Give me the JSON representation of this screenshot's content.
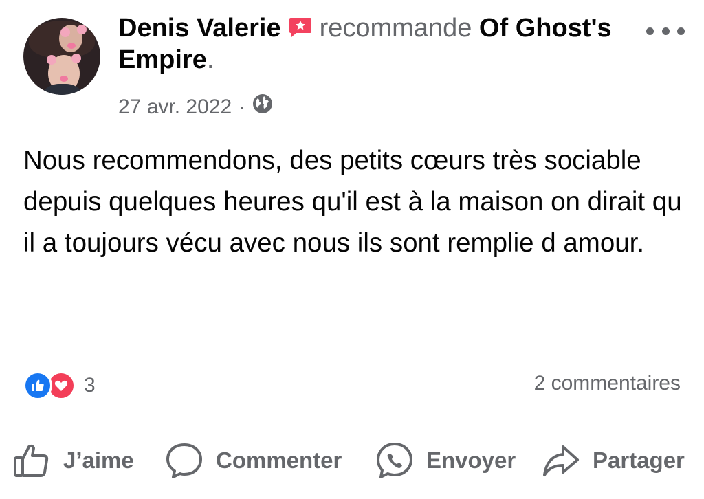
{
  "post": {
    "author": "Denis Valerie",
    "verb": "recommande",
    "page_name": "Of Ghost's Empire",
    "trailing_period": ".",
    "date": "27 avr. 2022",
    "separator": "·",
    "audience_icon": "globe-icon",
    "body": "Nous recommendons, des petits cœurs très sociable depuis quelques heures qu'il est à la maison on dirait qu il a toujours vécu avec nous ils sont remplie d amour."
  },
  "reactions": {
    "types": [
      "like-icon",
      "love-icon"
    ],
    "count": "3",
    "comments": "2 commentaires"
  },
  "actions": {
    "like": "J’aime",
    "comment": "Commenter",
    "send": "Envoyer",
    "share": "Partager"
  },
  "colors": {
    "like_blue": "#1877f2",
    "love_red": "#f33e58",
    "recommend_badge": "#f3425f",
    "muted_text": "#65676b"
  }
}
